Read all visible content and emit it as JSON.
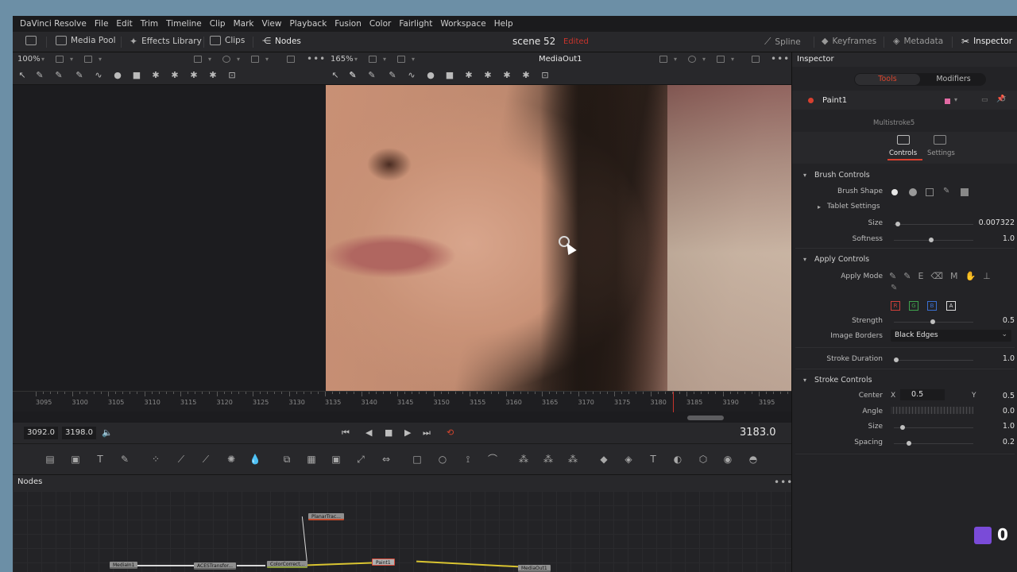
{
  "menu": [
    "DaVinci Resolve",
    "File",
    "Edit",
    "Trim",
    "Timeline",
    "Clip",
    "Mark",
    "View",
    "Playback",
    "Fusion",
    "Color",
    "Fairlight",
    "Workspace",
    "Help"
  ],
  "toolbar": {
    "media_pool": "Media Pool",
    "effects_library": "Effects Library",
    "clips": "Clips",
    "nodes": "Nodes",
    "scene": "scene 52",
    "status": "Edited",
    "spline": "Spline",
    "keyframes": "Keyframes",
    "metadata": "Metadata",
    "inspector": "Inspector"
  },
  "viewer": {
    "left_zoom": "100%",
    "right_zoom": "165%",
    "right_title": "MediaOut1"
  },
  "ruler": {
    "labels": [
      "3095",
      "3100",
      "3105",
      "3110",
      "3115",
      "3120",
      "3125",
      "3130",
      "3135",
      "3140",
      "3145",
      "3150",
      "3155",
      "3160",
      "3165",
      "3170",
      "3175",
      "3180",
      "3185",
      "3190",
      "3195"
    ]
  },
  "transport": {
    "in": "3092.0",
    "out": "3198.0",
    "current": "3183.0"
  },
  "nodes_panel": {
    "title": "Nodes",
    "nodes": [
      "PlanarTrac...",
      "MediaIn1",
      "ACESTransfor...",
      "ColorCorrect...",
      "Paint1",
      "MediaOut1"
    ]
  },
  "inspector": {
    "title": "Inspector",
    "tabs": [
      "Tools",
      "Modifiers"
    ],
    "tool_name": "Paint1",
    "subtitle": "Multistroke5",
    "subtabs": [
      "Controls",
      "Settings"
    ],
    "brush_controls": {
      "title": "Brush Controls",
      "brush_shape": "Brush Shape",
      "tablet_settings": "Tablet Settings",
      "size_label": "Size",
      "size": "0.007322",
      "softness_label": "Softness",
      "softness": "1.0"
    },
    "apply_controls": {
      "title": "Apply Controls",
      "apply_mode": "Apply Mode",
      "channels": [
        "R",
        "G",
        "B",
        "A"
      ],
      "strength_label": "Strength",
      "strength": "0.5",
      "image_borders_label": "Image Borders",
      "image_borders": "Black Edges",
      "stroke_duration_label": "Stroke Duration",
      "stroke_duration": "1.0"
    },
    "stroke_controls": {
      "title": "Stroke Controls",
      "center_label": "Center",
      "x_label": "X",
      "center_x": "0.5",
      "y_label": "Y",
      "center_y": "0.5",
      "angle_label": "Angle",
      "angle": "0.0",
      "size_label": "Size",
      "size": "1.0",
      "spacing_label": "Spacing",
      "spacing": "0.2"
    }
  },
  "overlay": {
    "counter": "0"
  },
  "colors": {
    "accent_red": "#c7342c",
    "status_red": "#c7342c",
    "channel_r": "#d0403a",
    "channel_g": "#3fa34d",
    "channel_b": "#3a6fd0"
  }
}
